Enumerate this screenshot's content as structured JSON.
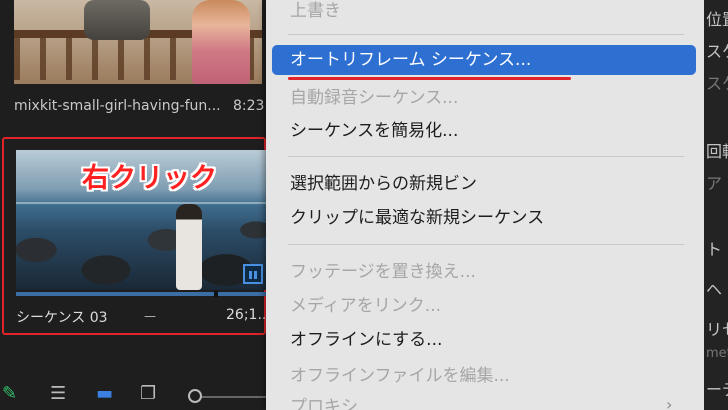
{
  "project_panel": {
    "clip1": {
      "name": "mixkit-small-girl-having-fun...",
      "duration": "8:23"
    },
    "sequence": {
      "name": "シーケンス 03",
      "duration": "26;1..."
    },
    "annotation": "右クリック"
  },
  "context_menu": {
    "items": [
      {
        "label": "上書き",
        "enabled": false
      },
      {
        "label": "オートリフレーム シーケンス...",
        "enabled": true,
        "highlighted": true
      },
      {
        "label": "自動録音シーケンス...",
        "enabled": false
      },
      {
        "label": "シーケンスを簡易化...",
        "enabled": true
      },
      {
        "label": "選択範囲からの新規ビン",
        "enabled": true
      },
      {
        "label": "クリップに最適な新規シーケンス",
        "enabled": true
      },
      {
        "label": "フッテージを置き換え...",
        "enabled": false
      },
      {
        "label": "メディアをリンク...",
        "enabled": false
      },
      {
        "label": "オフラインにする...",
        "enabled": true
      },
      {
        "label": "オフラインファイルを編集...",
        "enabled": false
      },
      {
        "label": "プロキシ",
        "enabled": false,
        "submenu": true
      }
    ]
  },
  "right_panel": {
    "labels": [
      "位置",
      "スケ",
      "スケ",
      "回転",
      "ア",
      "ト",
      "ヘ",
      "リセ",
      "met",
      "ーデ"
    ]
  },
  "colors": {
    "highlight": "#2e6fd2",
    "annotation_red": "#e0242a",
    "menu_bg": "#e5e5e5"
  }
}
